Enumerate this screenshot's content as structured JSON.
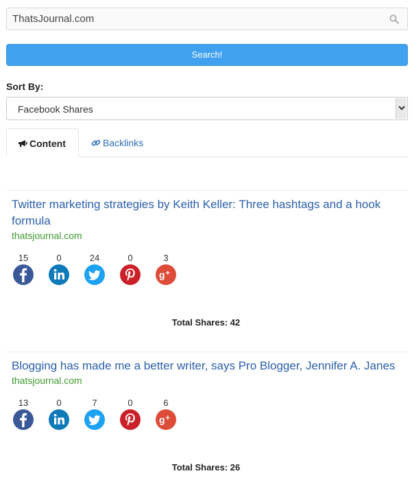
{
  "search": {
    "value": "ThatsJournal.com",
    "button_label": "Search!"
  },
  "sort": {
    "label": "Sort By:",
    "selected": "Facebook Shares"
  },
  "tabs": [
    {
      "label": "Content",
      "icon": "bullhorn-icon"
    },
    {
      "label": "Backlinks",
      "icon": "link-icon"
    }
  ],
  "articles": [
    {
      "title": "Twitter marketing strategies by Keith Keller: Three hashtags and a hook formula",
      "domain": "thatsjournal.com",
      "shares": {
        "facebook": "15",
        "linkedin": "0",
        "twitter": "24",
        "pinterest": "0",
        "googleplus": "3"
      },
      "total": "Total Shares: 42"
    },
    {
      "title": "Blogging has made me a better writer, says Pro Blogger, Jennifer A. Janes",
      "domain": "thatsjournal.com",
      "shares": {
        "facebook": "13",
        "linkedin": "0",
        "twitter": "7",
        "pinterest": "0",
        "googleplus": "6"
      },
      "total": "Total Shares: 26"
    }
  ],
  "colors": {
    "button": "#3fa1f0",
    "link": "#2b5fa8",
    "domain": "#3d9a2f",
    "facebook": "#3b5998",
    "linkedin": "#0e7ab8",
    "twitter": "#1da1f2",
    "pinterest": "#cb2027",
    "googleplus": "#dd4b39"
  }
}
